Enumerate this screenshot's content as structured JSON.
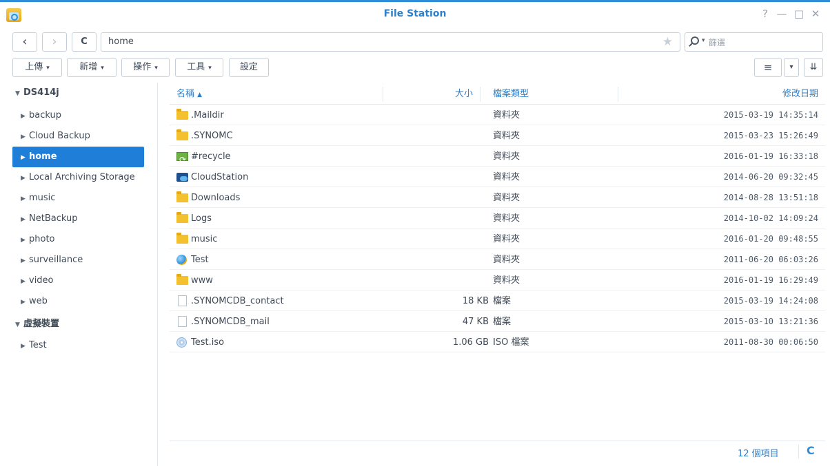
{
  "window": {
    "title": "File Station",
    "controls": {
      "help": "?",
      "minimize": "—",
      "maximize": "□",
      "close": "✕"
    }
  },
  "nav": {
    "back": "‹",
    "forward": "›",
    "refresh": "C",
    "path": "home",
    "favorite": "★",
    "search_placeholder": "篩選"
  },
  "toolbar": {
    "upload": "上傳",
    "create": "新增",
    "action": "操作",
    "tools": "工具",
    "settings": "設定",
    "view_list": "≡",
    "view_dropdown": "▾",
    "sort": "⇊"
  },
  "sidebar": {
    "root": "DS414j",
    "folders": [
      "backup",
      "Cloud Backup",
      "home",
      "Local Archiving Storage",
      "music",
      "NetBackup",
      "photo",
      "surveillance",
      "video",
      "web"
    ],
    "virtual_root": "虛擬裝置",
    "virtual_items": [
      "Test"
    ],
    "selected": "home"
  },
  "grid": {
    "columns": {
      "name": "名稱",
      "sort_indicator": "▲",
      "size": "大小",
      "type": "檔案類型",
      "modified": "修改日期"
    },
    "rows": [
      {
        "name": ".Maildir",
        "size": "",
        "type": "資料夾",
        "modified": "2015-03-19 14:35:14",
        "icon": "folder-icon"
      },
      {
        "name": ".SYNOMC",
        "size": "",
        "type": "資料夾",
        "modified": "2015-03-23 15:26:49",
        "icon": "folder-icon"
      },
      {
        "name": "#recycle",
        "size": "",
        "type": "資料夾",
        "modified": "2016-01-19 16:33:18",
        "icon": "recycle-icon"
      },
      {
        "name": "CloudStation",
        "size": "",
        "type": "資料夾",
        "modified": "2014-06-20 09:32:45",
        "icon": "cloud-icon"
      },
      {
        "name": "Downloads",
        "size": "",
        "type": "資料夾",
        "modified": "2014-08-28 13:51:18",
        "icon": "folder-icon"
      },
      {
        "name": "Logs",
        "size": "",
        "type": "資料夾",
        "modified": "2014-10-02 14:09:24",
        "icon": "folder-icon"
      },
      {
        "name": "music",
        "size": "",
        "type": "資料夾",
        "modified": "2016-01-20 09:48:55",
        "icon": "folder-icon"
      },
      {
        "name": "Test",
        "size": "",
        "type": "資料夾",
        "modified": "2011-06-20 06:03:26",
        "icon": "globe-icon"
      },
      {
        "name": "www",
        "size": "",
        "type": "資料夾",
        "modified": "2016-01-19 16:29:49",
        "icon": "folder-icon"
      },
      {
        "name": ".SYNOMCDB_contact",
        "size": "18 KB",
        "type": "檔案",
        "modified": "2015-03-19 14:24:08",
        "icon": "doc-icon"
      },
      {
        "name": ".SYNOMCDB_mail",
        "size": "47 KB",
        "type": "檔案",
        "modified": "2015-03-10 13:21:36",
        "icon": "doc-icon"
      },
      {
        "name": "Test.iso",
        "size": "1.06 GB",
        "type": "ISO 檔案",
        "modified": "2011-08-30 00:06:50",
        "icon": "disc-icon"
      }
    ]
  },
  "status": {
    "item_count": "12 個項目",
    "refresh": "C"
  }
}
